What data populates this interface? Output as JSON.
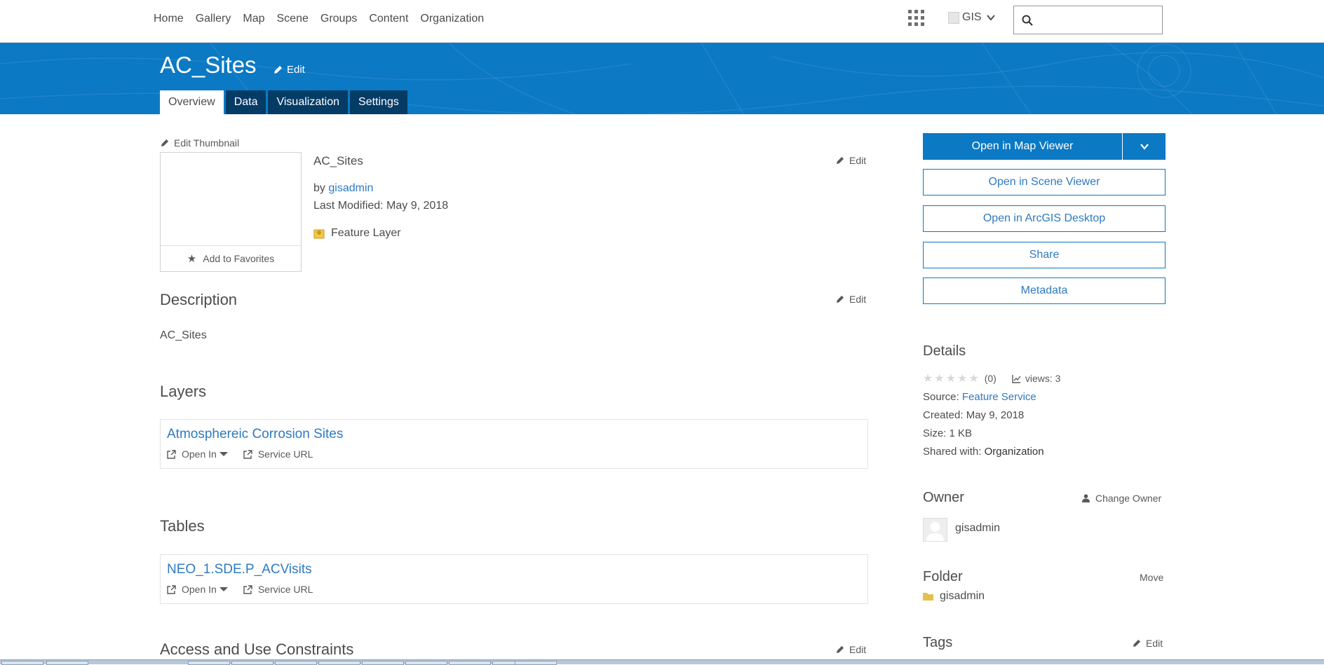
{
  "nav": {
    "links": [
      "Home",
      "Gallery",
      "Map",
      "Scene",
      "Groups",
      "Content",
      "Organization"
    ],
    "user_label": "GIS",
    "search_placeholder": ""
  },
  "banner": {
    "title": "AC_Sites",
    "edit_label": "Edit",
    "tabs": [
      "Overview",
      "Data",
      "Visualization",
      "Settings"
    ],
    "active_tab": "Overview"
  },
  "item": {
    "edit_thumbnail_label": "Edit Thumbnail",
    "add_favorites_label": "Add to Favorites",
    "name": "AC_Sites",
    "edit_label": "Edit",
    "by_prefix": "by",
    "owner": "gisadmin",
    "last_modified": "Last Modified: May 9, 2018",
    "type": "Feature Layer"
  },
  "description": {
    "title": "Description",
    "edit_label": "Edit",
    "text": "AC_Sites"
  },
  "layers": {
    "title": "Layers",
    "items": [
      {
        "name": "Atmosphereic Corrosion Sites",
        "open_in": "Open In",
        "service_url": "Service URL"
      }
    ]
  },
  "tables": {
    "title": "Tables",
    "items": [
      {
        "name": "NEO_1.SDE.P_ACVisits",
        "open_in": "Open In",
        "service_url": "Service URL"
      }
    ]
  },
  "constraints": {
    "title": "Access and Use Constraints",
    "edit_label": "Edit"
  },
  "actions": {
    "open_map_viewer": "Open in Map Viewer",
    "open_scene_viewer": "Open in Scene Viewer",
    "open_arcgis_desktop": "Open in ArcGIS Desktop",
    "share": "Share",
    "metadata": "Metadata"
  },
  "details": {
    "title": "Details",
    "rating_stars": "★★★★★",
    "rating_count": "(0)",
    "views": "views: 3",
    "source_label": "Source:",
    "source_value": "Feature Service",
    "created": "Created: May 9, 2018",
    "size": "Size: 1 KB",
    "shared_label": "Shared with:",
    "shared_value": "Organization"
  },
  "owner": {
    "title": "Owner",
    "change_label": "Change Owner",
    "name": "gisadmin"
  },
  "folder": {
    "title": "Folder",
    "move_label": "Move",
    "name": "gisadmin"
  },
  "tags": {
    "title": "Tags",
    "edit_label": "Edit"
  },
  "colors": {
    "brand_blue": "#0b79c4",
    "tab_dark": "#053c66",
    "link_blue": "#2f7ac0"
  }
}
